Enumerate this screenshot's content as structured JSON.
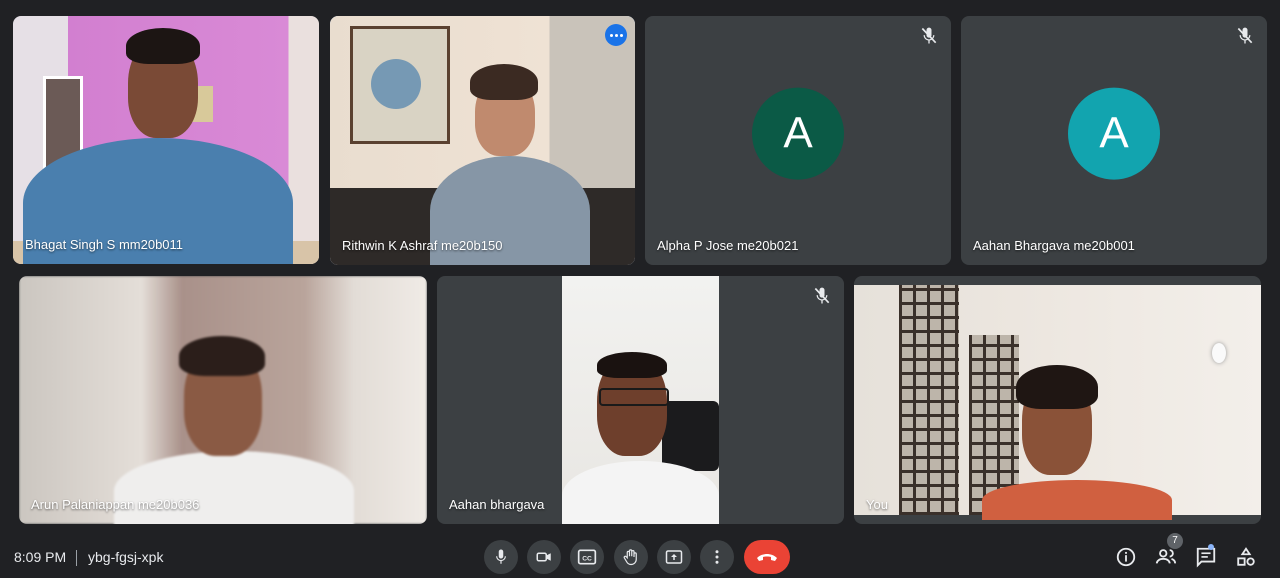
{
  "colors": {
    "background": "#202124",
    "tile": "#3c4043",
    "active_border": "#8ab4f8",
    "end_call": "#ea4335",
    "avatar_alpha": "#0b5a46",
    "avatar_aahan": "#12a4af"
  },
  "participants": [
    {
      "name": "Bhagat Singh S mm20b011",
      "muted": false
    },
    {
      "name": "Rithwin K Ashraf me20b150",
      "muted": false,
      "active": true
    },
    {
      "name": "Alpha P Jose me20b021",
      "muted": true,
      "avatar_letter": "A"
    },
    {
      "name": "Aahan Bhargava me20b001",
      "muted": true,
      "avatar_letter": "A"
    },
    {
      "name": "Arun Palaniappan me20b036",
      "muted": false
    },
    {
      "name": "Aahan bhargava",
      "muted": true
    },
    {
      "name": "You",
      "muted": false
    }
  ],
  "bottom_bar": {
    "time": "8:09 PM",
    "meeting_code": "ybg-fgsj-xpk",
    "participants_count": "7",
    "controls": [
      "mic-icon",
      "camera-icon",
      "captions-icon",
      "raise-hand-icon",
      "present-icon",
      "more-options-icon",
      "end-call-icon"
    ],
    "right_icons": [
      "info-icon",
      "people-icon",
      "chat-icon",
      "activities-icon"
    ]
  }
}
